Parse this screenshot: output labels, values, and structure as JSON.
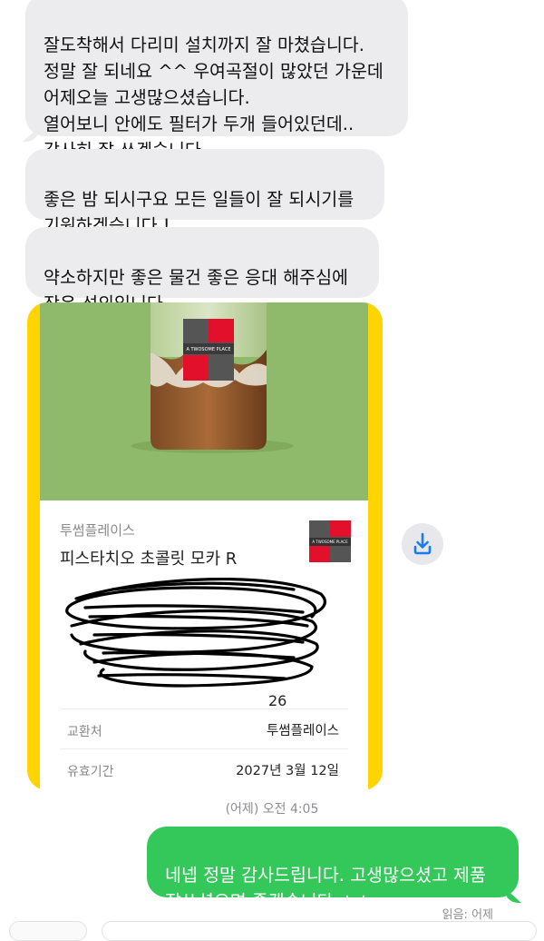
{
  "messages": {
    "incoming": [
      "잘도착해서 다리미 설치까지 잘 마쳤습니다.\n정말 잘 되네요 ^^ 우여곡절이 많았던 가운데\n어제오늘 고생많으셨습니다.\n열어보니 안에도 필터가 두개 들어있던데..\n감사히 잘 쓰겠습니다.",
      "좋은 밤 되시구요 모든 일들이 잘 되시기를\n기원하겠습니다 !",
      "약소하지만 좋은 물건 좋은 응대 해주심에\n작은 성의입니다."
    ],
    "outgoing": "네넵 정말 감사드립니다. 고생많으셨고 제품\n잘쓰셨으면 좋겠습니다 ㅎㅎ"
  },
  "gift": {
    "brand": "투썸플레이스",
    "product": "피스타치오 초콜릿 모카 R",
    "cup_logo_text": "A TWOSOME PLACE",
    "exchange_label": "교환처",
    "exchange_value": "투썸플레이스",
    "validity_label": "유효기간",
    "validity_value": "2027년 3월 12일",
    "partial_code_suffix": "26"
  },
  "timestamp": "(어제) 오전 4:05",
  "read_receipt": "읽음: 어제",
  "colors": {
    "incoming_bubble": "#ececef",
    "outgoing_bubble": "#34c759",
    "gift_frame": "#ffd400",
    "product_bg": "#8fba6b",
    "brand_red": "#e3102c"
  },
  "icons": {
    "download": "download-icon"
  }
}
